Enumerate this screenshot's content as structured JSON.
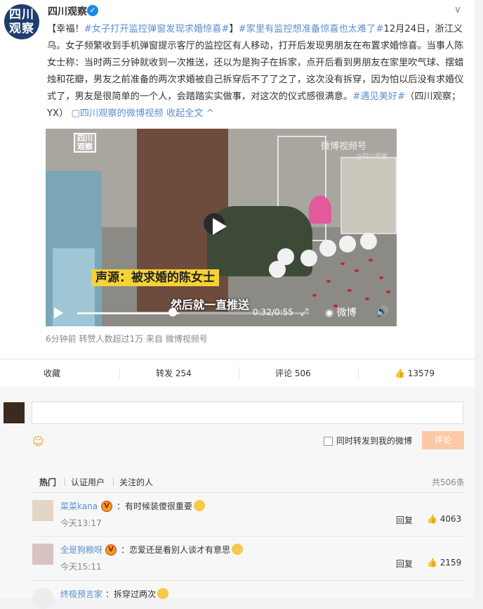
{
  "post": {
    "author": "四川观察",
    "avatar_text_line1": "四川",
    "avatar_text_line2": "观察",
    "text_segments": [
      {
        "text": "【幸福！",
        "link": false
      },
      {
        "text": "#女子打开监控弹窗发现求婚惊喜#",
        "link": true
      },
      {
        "text": "】",
        "link": false
      },
      {
        "text": "#家里有监控想准备惊喜也太难了#",
        "link": true
      },
      {
        "text": "12月24日，浙江义乌。女子频繁收到手机弹窗提示客厅的监控区有人移动，打开后发现男朋友在布置求婚惊喜。当事人陈女士称：当时两三分钟就收到一次推送，还以为是狗子在拆家，点开后看到男朋友在家里吹气球、摆蜡烛和花瓣，男友之前准备的两次求婚被自己拆穿后不了了之了，这次没有拆穿，因为怕以后没有求婚仪式了，男友是很简单的一个人，会踏踏实实做事，对这次的仪式感很满意。",
        "link": false
      },
      {
        "text": "#遇见美好#",
        "link": true
      },
      {
        "text": "（四川观察；YX）",
        "link": false
      },
      {
        "text": " ▢四川观察的微博视频",
        "link": true
      },
      {
        "text": " 收起全文 ^",
        "link": true
      }
    ],
    "meta": "6分钟前 转赞人数超过1万 来自 微博视频号"
  },
  "video": {
    "logo_line1": "四川",
    "logo_line2": "观察",
    "watermark": "微博视频号",
    "watermark_sub": "@四川观察",
    "caption": "声源：被求婚的陈女士",
    "subtitle": "然后就一直推送",
    "time": "0:32/0:55",
    "brand": "微博",
    "progress": 0.58
  },
  "actions": {
    "collect": "收藏",
    "repost": "转发 254",
    "comment": "评论 506",
    "like": "13579"
  },
  "compose": {
    "placeholder": "",
    "repost_label": "同时转发到我的微博",
    "submit": "评论"
  },
  "tabs": {
    "hot": "热门",
    "verified": "认证用户",
    "following": "关注的人",
    "total": "共506条"
  },
  "comments": [
    {
      "user": "菜菜kana",
      "text": "：有时候装傻很重要",
      "time": "今天13:17",
      "reply": "回复",
      "likes": "4063"
    },
    {
      "user": "全是狗粮呀",
      "text": "：恋爱还是看别人谈才有意思",
      "time": "今天15:11",
      "reply": "回复",
      "likes": "2159"
    },
    {
      "user": "终极预言家",
      "text": "：拆穿过两次",
      "time": "",
      "reply": "",
      "likes": ""
    }
  ],
  "colors": {
    "link": "#5a8fd0",
    "caption_bg": "#f5d235",
    "submit_bg": "#fcc9a6"
  }
}
